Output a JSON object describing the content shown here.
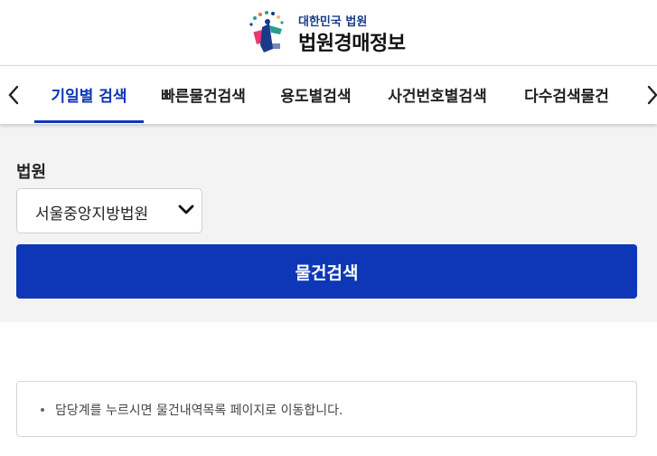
{
  "header": {
    "org_name": "대한민국 법원",
    "site_title": "법원경매정보",
    "logo_icon": "court-emblem-icon"
  },
  "tabs": {
    "prev_icon": "chevron-left-icon",
    "next_icon": "chevron-right-icon",
    "items": [
      {
        "label": "기일별 검색",
        "active": true
      },
      {
        "label": "빠른물건검색",
        "active": false
      },
      {
        "label": "용도별검색",
        "active": false
      },
      {
        "label": "사건번호별검색",
        "active": false
      },
      {
        "label": "다수검색물건",
        "active": false
      }
    ]
  },
  "search": {
    "court_label": "법원",
    "court_selected": "서울중앙지방법원",
    "submit_label": "물건검색"
  },
  "info": {
    "items": [
      "담당계를 누르시면 물건내역목록 페이지로 이동합니다."
    ]
  },
  "colors": {
    "accent": "#0e37b8",
    "panel_bg": "#f3f3f3"
  }
}
